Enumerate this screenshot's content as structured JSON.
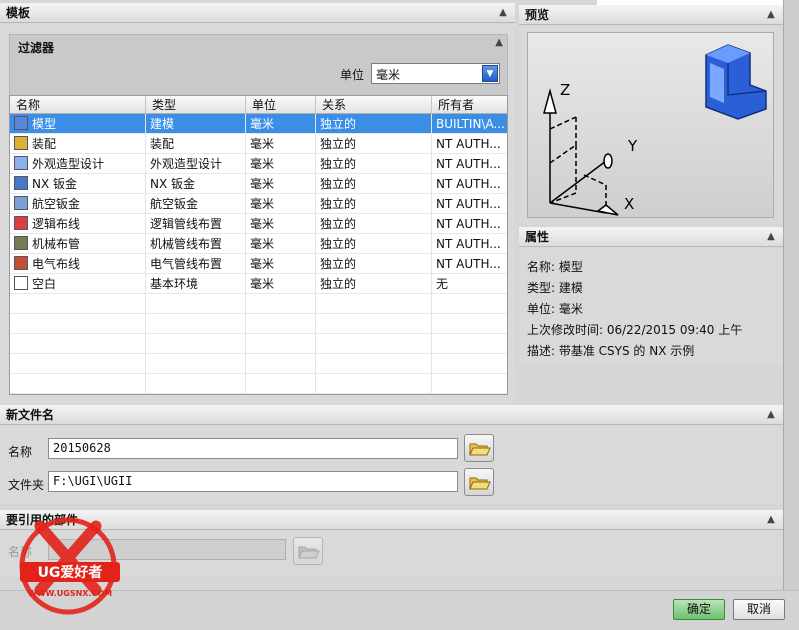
{
  "template": {
    "title": "模板",
    "filter": {
      "title": "过滤器",
      "unit_label": "单位",
      "unit_value": "毫米"
    },
    "columns": [
      "名称",
      "类型",
      "单位",
      "关系",
      "所有者"
    ],
    "rows": [
      {
        "name": "模型",
        "type": "建模",
        "unit": "毫米",
        "relation": "独立的",
        "owner": "BUILTIN\\A...",
        "icon": "model-icon"
      },
      {
        "name": "装配",
        "type": "装配",
        "unit": "毫米",
        "relation": "独立的",
        "owner": "NT AUTH...",
        "icon": "assembly-icon"
      },
      {
        "name": "外观造型设计",
        "type": "外观造型设计",
        "unit": "毫米",
        "relation": "独立的",
        "owner": "NT AUTH...",
        "icon": "shape-studio-icon"
      },
      {
        "name": "NX 钣金",
        "type": "NX 钣金",
        "unit": "毫米",
        "relation": "独立的",
        "owner": "NT AUTH...",
        "icon": "sheet-metal-icon"
      },
      {
        "name": "航空钣金",
        "type": "航空钣金",
        "unit": "毫米",
        "relation": "独立的",
        "owner": "NT AUTH...",
        "icon": "aero-sheet-metal-icon"
      },
      {
        "name": "逻辑布线",
        "type": "逻辑管线布置",
        "unit": "毫米",
        "relation": "独立的",
        "owner": "NT AUTH...",
        "icon": "logical-routing-icon"
      },
      {
        "name": "机械布管",
        "type": "机械管线布置",
        "unit": "毫米",
        "relation": "独立的",
        "owner": "NT AUTH...",
        "icon": "mechanical-routing-icon"
      },
      {
        "name": "电气布线",
        "type": "电气管线布置",
        "unit": "毫米",
        "relation": "独立的",
        "owner": "NT AUTH...",
        "icon": "electrical-routing-icon"
      },
      {
        "name": "空白",
        "type": "基本环境",
        "unit": "毫米",
        "relation": "独立的",
        "owner": "无",
        "icon": "blank-icon"
      }
    ]
  },
  "preview": {
    "title": "预览",
    "axes": {
      "z": "Z",
      "y": "Y",
      "x": "X"
    }
  },
  "properties": {
    "title": "属性",
    "name": "名称: 模型",
    "type": "类型: 建模",
    "unit": "单位: 毫米",
    "modified": "上次修改时间: 06/22/2015 09:40 上午",
    "description": "描述: 带基准 CSYS 的 NX 示例"
  },
  "new_file": {
    "title": "新文件名",
    "name_label": "名称",
    "name_value": "20150628",
    "folder_label": "文件夹",
    "folder_value": "F:\\UGI\\UGII"
  },
  "referenced_part": {
    "title": "要引用的部件",
    "name_label": "名称",
    "name_value": ""
  },
  "buttons": {
    "ok": "确定",
    "cancel": "取消"
  },
  "watermark": {
    "brand": "UG爱好者",
    "url": "WWW.UGSNX.COM"
  },
  "colors": {
    "selected_row": "#3b8ee6",
    "ok_button": "#6fc06f"
  }
}
